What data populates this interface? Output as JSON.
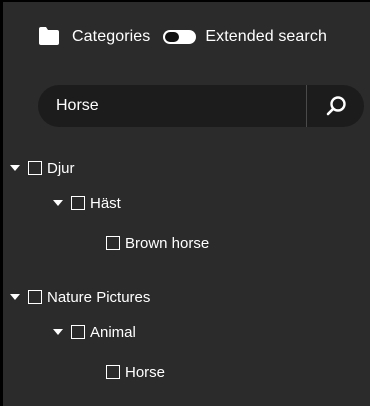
{
  "header": {
    "categories_label": "Categories",
    "extended_search_label": "Extended search",
    "extended_search_on": true
  },
  "search": {
    "value": "Horse",
    "button_icon": "search-icon"
  },
  "tree": [
    {
      "label": "Djur",
      "expanded": true
    },
    {
      "label": "Häst",
      "expanded": true
    },
    {
      "label": "Brown horse"
    },
    {
      "label": "Nature Pictures",
      "expanded": true
    },
    {
      "label": "Animal",
      "expanded": true
    },
    {
      "label": "Horse"
    }
  ],
  "colors": {
    "panel_bg": "#2b2b2b",
    "search_bg": "#1c1c1c",
    "text": "#ffffff"
  }
}
